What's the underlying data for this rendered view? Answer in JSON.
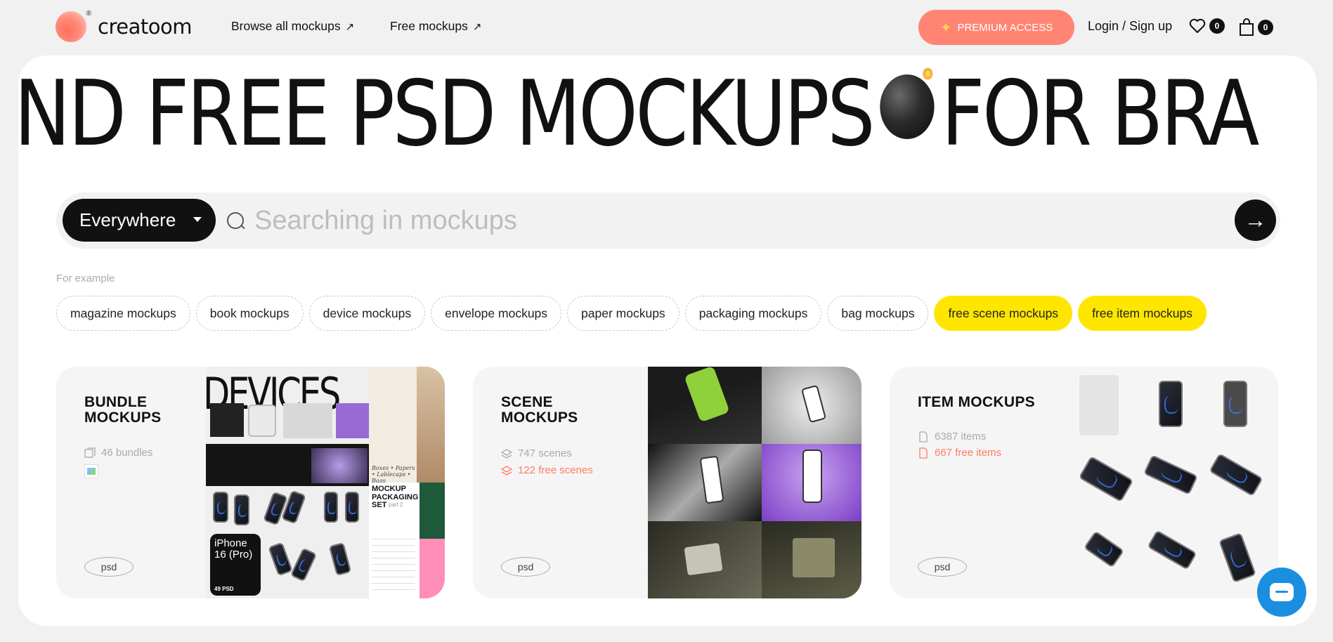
{
  "header": {
    "logo_text": "creatoom",
    "logo_reg": "®",
    "nav": [
      {
        "label": "Browse all mockups",
        "icon": "arrow-up-right-icon"
      },
      {
        "label": "Free mockups",
        "icon": "arrow-up-right-icon"
      }
    ],
    "premium_label": "PREMIUM ACCESS",
    "login_label": "Login / Sign up",
    "wishlist_count": "0",
    "cart_count": "0"
  },
  "marquee": {
    "text_before": "ND FREE PSD MOCKUPS",
    "text_after": "FOR BRA",
    "emoji": "bomb-icon"
  },
  "search": {
    "scope_label": "Everywhere",
    "placeholder": "Searching in mockups"
  },
  "examples": {
    "label": "For example",
    "chips": [
      {
        "label": "magazine mockups",
        "highlight": false
      },
      {
        "label": "book mockups",
        "highlight": false
      },
      {
        "label": "device mockups",
        "highlight": false
      },
      {
        "label": "envelope mockups",
        "highlight": false
      },
      {
        "label": "paper mockups",
        "highlight": false
      },
      {
        "label": "packaging mockups",
        "highlight": false
      },
      {
        "label": "bag mockups",
        "highlight": false
      },
      {
        "label": "free scene mockups",
        "highlight": true
      },
      {
        "label": "free item mockups",
        "highlight": true
      }
    ]
  },
  "cards": {
    "bundle": {
      "title_1": "BUNDLE",
      "title_2": "MOCKUPS",
      "stat": "46 bundles",
      "tag": "psd",
      "collage_texts": {
        "devices": "DEVICES",
        "iphone": "iPhone 16 (Pro)",
        "psd_count": "49 PSD",
        "packaging": "MOCKUP PACKAGING SET",
        "packaging_part": "part 2",
        "boxes": "Boxes • Papers • Lablecaps • Bags"
      }
    },
    "scene": {
      "title_1": "SCENE",
      "title_2": "MOCKUPS",
      "stat": "747 scenes",
      "free_stat": "122 free scenes",
      "tag": "psd"
    },
    "item": {
      "title_1": "ITEM MOCKUPS",
      "stat": "6387 items",
      "free_stat": "667 free items",
      "tag": "psd"
    }
  },
  "colors": {
    "accent": "#ff8474",
    "highlight": "#ffe600",
    "chat": "#1a8fe0"
  }
}
